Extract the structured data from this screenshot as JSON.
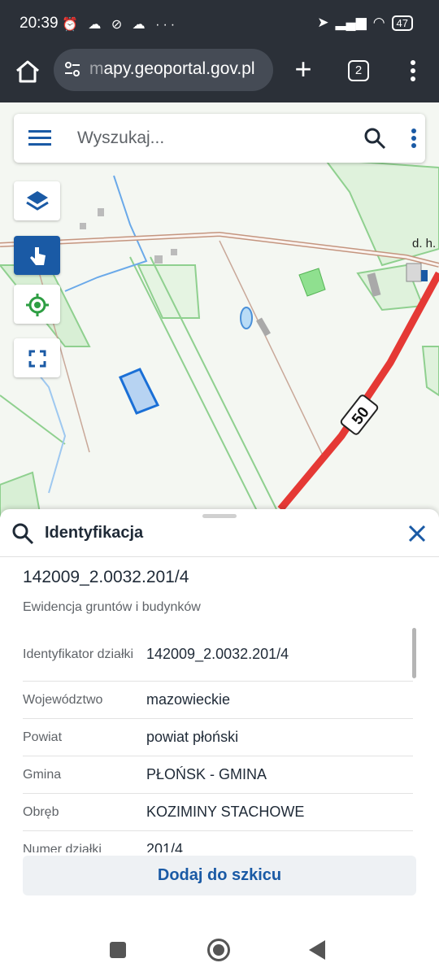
{
  "status_bar": {
    "time": "20:39",
    "battery": "47",
    "more": "···"
  },
  "browser": {
    "url": "mapy.geoportal.gov.pl",
    "url_prefix_faded": "m",
    "tab_count": "2"
  },
  "map": {
    "search_placeholder": "Wyszukaj...",
    "speed_sign": "50",
    "place_label": "d. h.",
    "colors": {
      "road": "#e53935",
      "highlight": "#1a5aa5",
      "green": "#6fc96f"
    }
  },
  "sheet": {
    "title": "Identyfikacja",
    "parcel_id": "142009_2.0032.201/4",
    "subtitle": "Ewidencja gruntów i budynków",
    "rows": [
      {
        "key": "Identyfikator działki",
        "value": "142009_2.0032.201/4"
      },
      {
        "key": "Województwo",
        "value": "mazowieckie"
      },
      {
        "key": "Powiat",
        "value": "powiat płoński"
      },
      {
        "key": "Gmina",
        "value": "PŁOŃSK - GMINA"
      },
      {
        "key": "Obręb",
        "value": "KOZIMINY STACHOWE"
      },
      {
        "key": "Numer działki",
        "value": "201/4"
      }
    ],
    "add_button": "Dodaj do szkicu"
  },
  "icons": {
    "home": "home-icon",
    "site_settings": "tune-icon",
    "new_tab": "plus-icon",
    "tabs": "tabs-icon",
    "menu": "kebab-icon",
    "hamburger": "menu-icon",
    "search": "search-icon",
    "layers": "layers-icon",
    "touch": "touch-icon",
    "locate": "locate-icon",
    "fullscreen": "fullscreen-icon",
    "close": "close-icon"
  }
}
